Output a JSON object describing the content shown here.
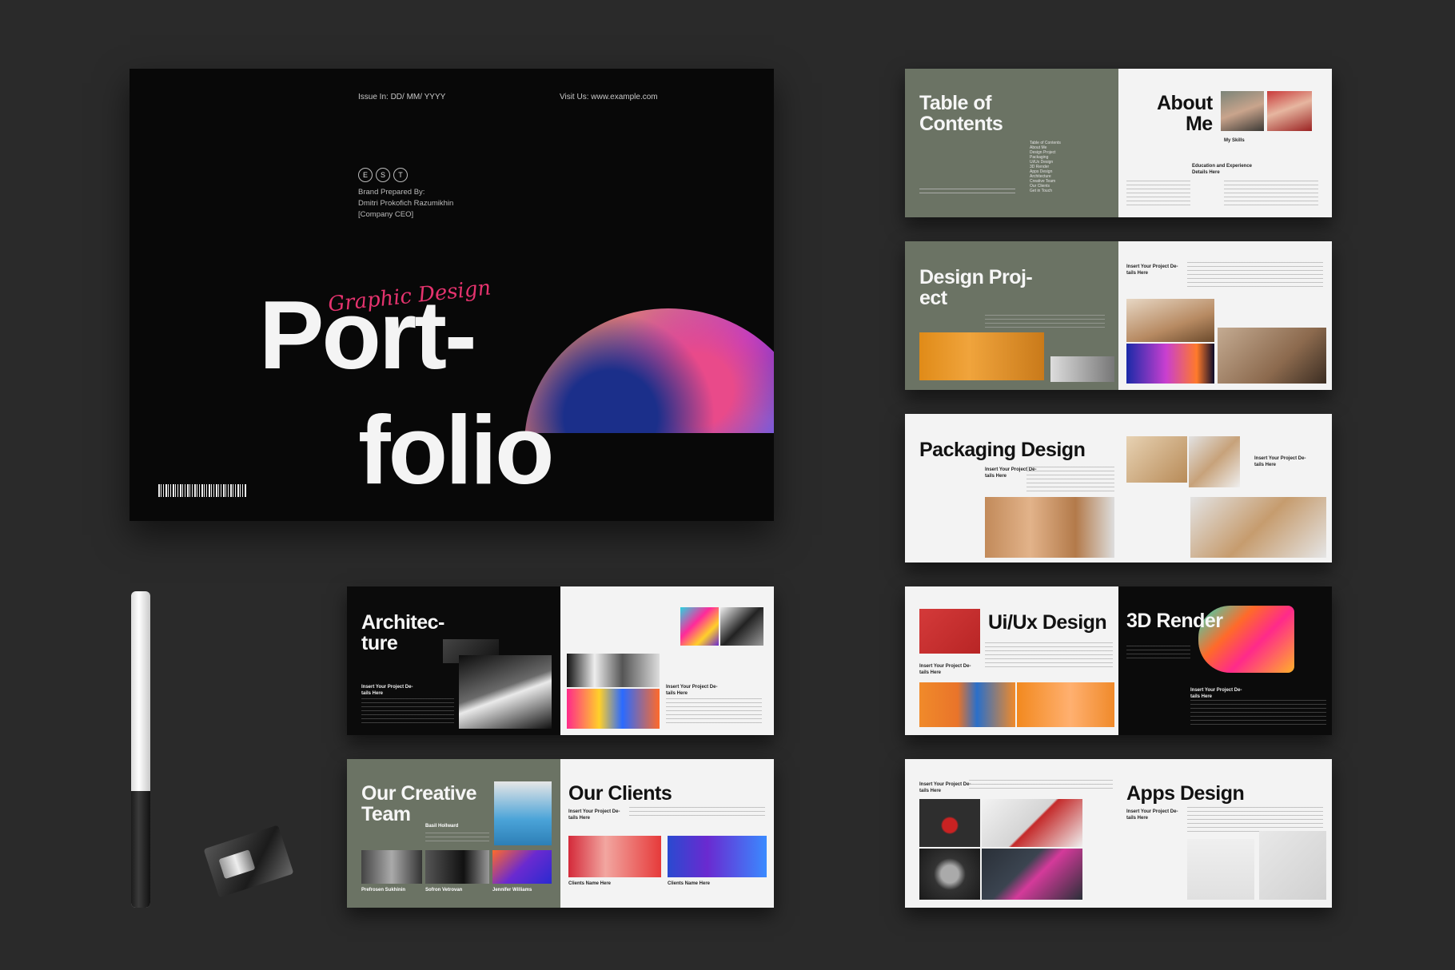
{
  "cover": {
    "issue": "Issue In: DD/ MM/ YYYY",
    "visit": "Visit Us: www.example.com",
    "est": [
      "E",
      "S",
      "T"
    ],
    "prepared": "Brand Prepared By:\nDmitri Prokofich Razumikhin\n[Company CEO]",
    "script_title": "Graphic Design",
    "title_line1": "Port-",
    "title_line2": "folio"
  },
  "spreads": {
    "toc": {
      "title": "Table of\nContents",
      "items": "Table of Contents\nAbout Me\nDesign Project\nPackaging\nUi/Ux Design\n3D Render\nApps Design\nArchitecture\nCreative Team\nOur Clients\nGet in Touch"
    },
    "about": {
      "title": "About\nMe",
      "skills": "My Skills",
      "education": "Education and Experience\nDetails Here"
    },
    "design_project": {
      "title": "Design Proj-\nect",
      "insert": "Insert Your Project De-\ntails Here"
    },
    "packaging": {
      "title": "Packaging Design",
      "insert": "Insert Your Project De-\ntails Here"
    },
    "uiux": {
      "title": "Ui/Ux Design",
      "insert": "Insert Your Project De-\ntails Here"
    },
    "render3d": {
      "title": "3D Render",
      "insert": "Insert Your Project De-\ntails Here"
    },
    "apps": {
      "title": "Apps Design",
      "insert": "Insert Your Project De-\ntails Here"
    },
    "apps_left": {
      "insert": "Insert Your Project De-\ntails Here"
    },
    "architecture": {
      "title": "Architec-\nture",
      "insert": "Insert Your Project De-\ntails Here"
    },
    "arch_right": {
      "insert": "Insert Your Project De-\ntails Here"
    },
    "team": {
      "title": "Our Creative\nTeam",
      "member1": "Basil Hollward",
      "member2": "Prefrosen Sukhinin",
      "member3": "Sofron Vetrovan",
      "member4": "Jennifer Williams"
    },
    "clients": {
      "title": "Our Clients",
      "insert": "Insert Your Project De-\ntails Here",
      "client1": "Clients Name Here",
      "client2": "Clients Name Here"
    }
  },
  "colors": {
    "background": "#2a2a2a",
    "cover": "#080808",
    "olive": "#6b7364",
    "accent": "#e5336e"
  }
}
